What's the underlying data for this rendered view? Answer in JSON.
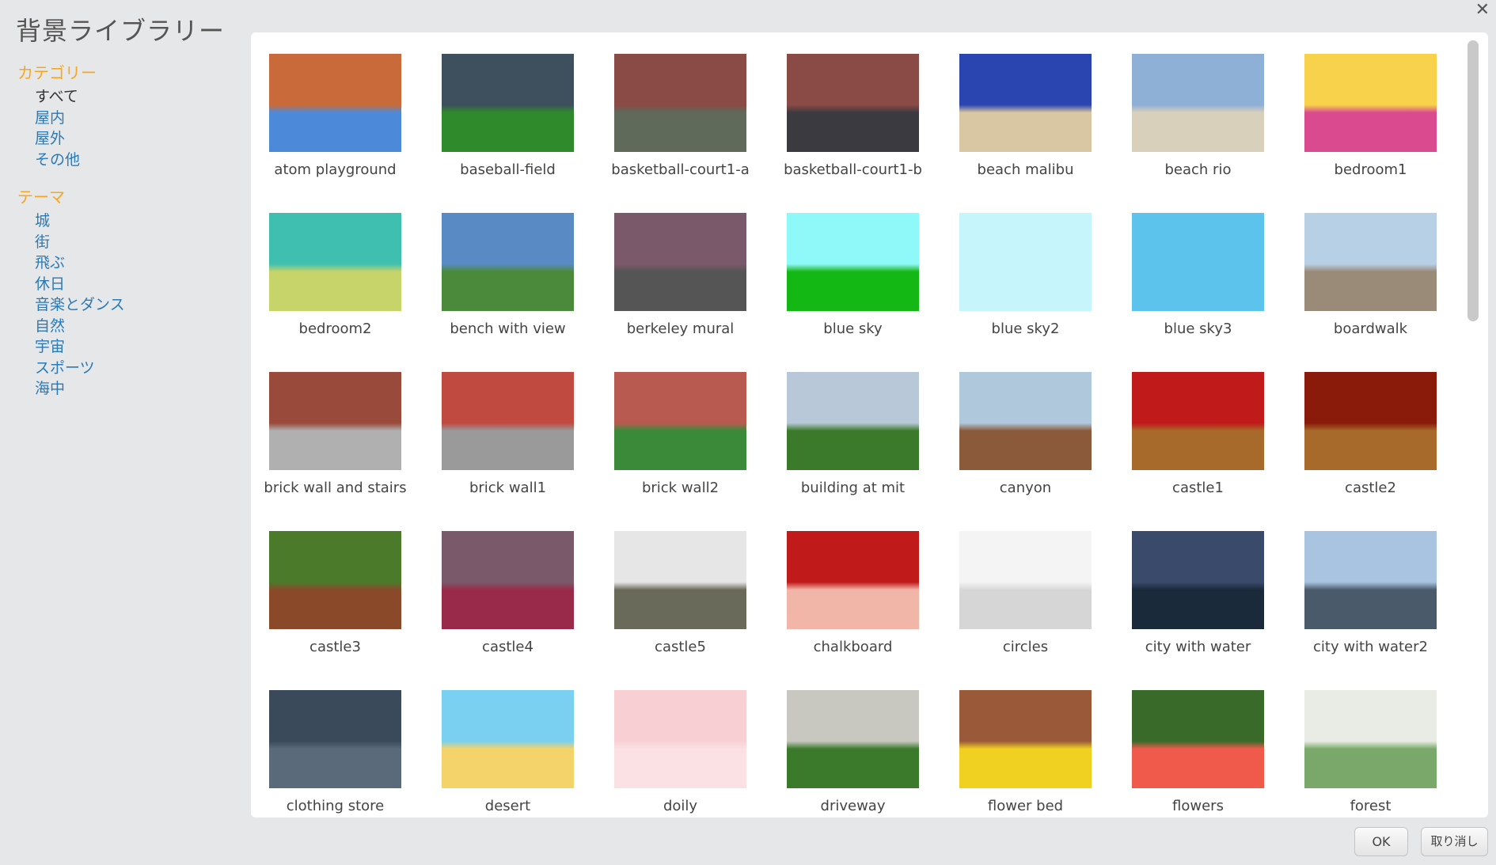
{
  "dialog": {
    "title": "背景ライブラリー"
  },
  "sidebar": {
    "category_title": "カテゴリー",
    "categories": [
      "すべて",
      "屋内",
      "屋外",
      "その他"
    ],
    "theme_title": "テーマ",
    "themes": [
      "城",
      "街",
      "飛ぶ",
      "休日",
      "音楽とダンス",
      "自然",
      "宇宙",
      "スポーツ",
      "海中"
    ]
  },
  "backdrops": [
    {
      "name": "atom playground",
      "colors": [
        "#c96a3a",
        "#4c8ad9"
      ]
    },
    {
      "name": "baseball-field",
      "colors": [
        "#3e4f5e",
        "#2f8a2c"
      ]
    },
    {
      "name": "basketball-court1-a",
      "colors": [
        "#8a4a45",
        "#5f6a5a"
      ]
    },
    {
      "name": "basketball-court1-b",
      "colors": [
        "#8a4a45",
        "#3a3a40"
      ]
    },
    {
      "name": "beach malibu",
      "colors": [
        "#2a45b0",
        "#d9c7a4"
      ]
    },
    {
      "name": "beach rio",
      "colors": [
        "#8fb0d6",
        "#d9d0bc"
      ]
    },
    {
      "name": "bedroom1",
      "colors": [
        "#f7d24a",
        "#d94a8f"
      ]
    },
    {
      "name": "bedroom2",
      "colors": [
        "#3fbfb0",
        "#c6d46a"
      ]
    },
    {
      "name": "bench with view",
      "colors": [
        "#5a8ac4",
        "#4a8a3a"
      ]
    },
    {
      "name": "berkeley mural",
      "colors": [
        "#7a5a6a",
        "#555555"
      ]
    },
    {
      "name": "blue sky",
      "colors": [
        "#8ff8f8",
        "#14b814"
      ]
    },
    {
      "name": "blue sky2",
      "colors": [
        "#c6f6fc",
        "#c6f6fc"
      ]
    },
    {
      "name": "blue sky3",
      "colors": [
        "#5bc3ec",
        "#5bc3ec"
      ]
    },
    {
      "name": "boardwalk",
      "colors": [
        "#b8d0e6",
        "#9a8a78"
      ]
    },
    {
      "name": "brick wall and stairs",
      "colors": [
        "#9a4a3a",
        "#b0b0b0"
      ]
    },
    {
      "name": "brick wall1",
      "colors": [
        "#c04a40",
        "#9a9a9a"
      ]
    },
    {
      "name": "brick wall2",
      "colors": [
        "#b85a50",
        "#3a8a3a"
      ]
    },
    {
      "name": "building at mit",
      "colors": [
        "#b8c8d8",
        "#3a7a2a"
      ]
    },
    {
      "name": "canyon",
      "colors": [
        "#b0c8dc",
        "#8a5a3a"
      ]
    },
    {
      "name": "castle1",
      "colors": [
        "#c01a1a",
        "#a86a2a"
      ]
    },
    {
      "name": "castle2",
      "colors": [
        "#8a1a0a",
        "#a86a2a"
      ]
    },
    {
      "name": "castle3",
      "colors": [
        "#4a7a2a",
        "#8a4a2a"
      ]
    },
    {
      "name": "castle4",
      "colors": [
        "#7a5a6a",
        "#9a2a4a"
      ]
    },
    {
      "name": "castle5",
      "colors": [
        "#e6e6e6",
        "#6a6a5a"
      ]
    },
    {
      "name": "chalkboard",
      "colors": [
        "#c01a1a",
        "#f2b6a8"
      ]
    },
    {
      "name": "circles",
      "colors": [
        "#f4f4f4",
        "#d6d6d6"
      ]
    },
    {
      "name": "city with water",
      "colors": [
        "#3a4a6a",
        "#1a2a3a"
      ]
    },
    {
      "name": "city with water2",
      "colors": [
        "#a8c4e0",
        "#4a5a6a"
      ]
    },
    {
      "name": "clothing store",
      "colors": [
        "#3a4a5a",
        "#5a6a7a"
      ]
    },
    {
      "name": "desert",
      "colors": [
        "#7ad0f0",
        "#f4d46a"
      ]
    },
    {
      "name": "doily",
      "colors": [
        "#f8d0d4",
        "#fbe0e4"
      ]
    },
    {
      "name": "driveway",
      "colors": [
        "#c8c8c0",
        "#3a7a2a"
      ]
    },
    {
      "name": "flower bed",
      "colors": [
        "#9a5a3a",
        "#f0d020"
      ]
    },
    {
      "name": "flowers",
      "colors": [
        "#3a6a2a",
        "#f05a4a"
      ]
    },
    {
      "name": "forest",
      "colors": [
        "#e8ece4",
        "#7aa86a"
      ]
    }
  ],
  "buttons": {
    "ok": "OK",
    "cancel": "取り消し"
  },
  "icons": {
    "close": "close-icon"
  }
}
